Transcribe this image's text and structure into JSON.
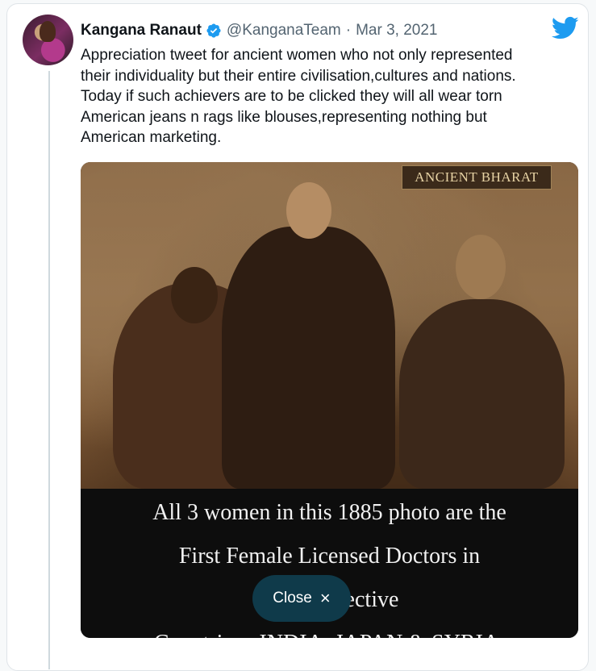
{
  "tweet": {
    "author_name": "Kangana Ranaut",
    "handle": "@KanganaTeam",
    "separator": "·",
    "date": "Mar 3, 2021",
    "text_lines": [
      "Appreciation tweet for ancient women who not only represented",
      "their individuality but their entire civilisation,cultures and nations.",
      "Today if such achievers are to be clicked they will all wear torn",
      "American jeans n rags like blouses,representing nothing but",
      "American marketing."
    ]
  },
  "media": {
    "badge": "ANCIENT BHARAT",
    "caption_lines": [
      "All 3 women in this 1885 photo are the",
      "First Female Licensed Doctors in",
      "their respective",
      "Countries : INDIA, JAPAN & SYRIA."
    ]
  },
  "overlay": {
    "close_label": "Close",
    "close_icon": "×"
  },
  "colors": {
    "brand_blue": "#1d9bf0",
    "text": "#0f1419",
    "secondary_text": "#536471",
    "close_pill": "#0f3a4a"
  },
  "icons": [
    "verified-badge-icon",
    "twitter-bird-icon",
    "close-icon"
  ]
}
